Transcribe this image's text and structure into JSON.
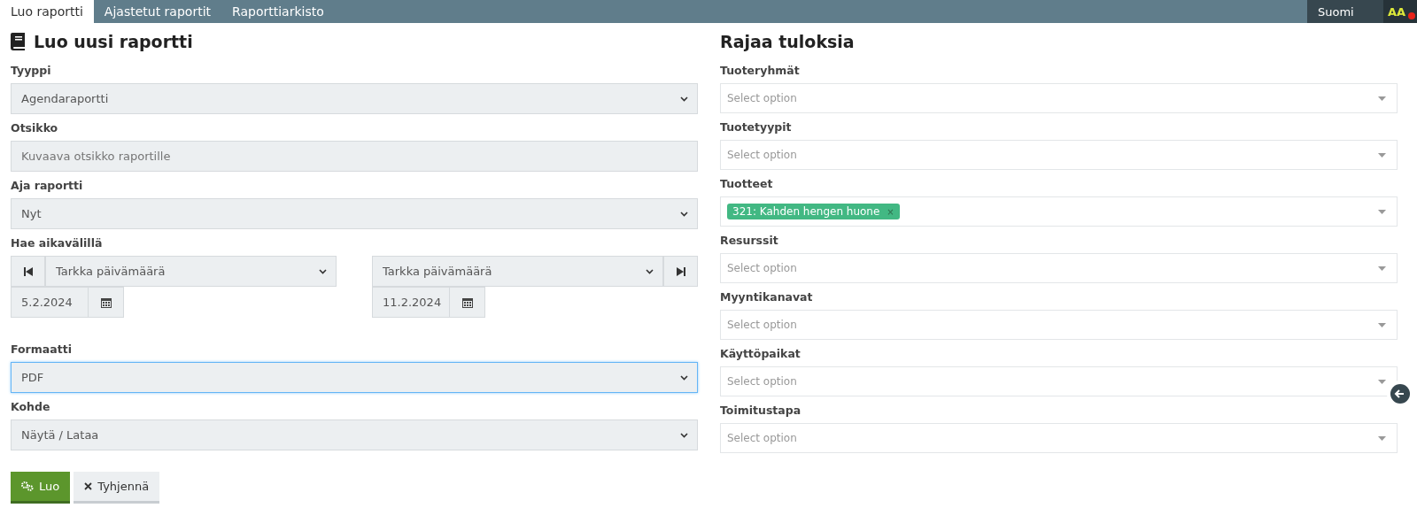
{
  "tabs": [
    {
      "label": "Luo raportti",
      "selected": true
    },
    {
      "label": "Ajastetut raportit",
      "selected": false
    },
    {
      "label": "Raporttiarkisto",
      "selected": false
    }
  ],
  "language": "Suomi",
  "accessibility": "AA",
  "form": {
    "title": "Luo uusi raportti",
    "fields_top": [
      {
        "kind": "select",
        "label": "Tyyppi",
        "value": "Agendaraportti",
        "focused": false
      },
      {
        "kind": "text",
        "label": "Otsikko",
        "placeholder": "Kuvaava otsikko raportille",
        "focused": false
      },
      {
        "kind": "select",
        "label": "Aja raportti",
        "value": "Nyt",
        "focused": false
      }
    ],
    "date_range": {
      "label": "Hae aikavälillä",
      "start": {
        "mode": "Tarkka päivämäärä",
        "date": "5.2.2024"
      },
      "end": {
        "mode": "Tarkka päivämäärä",
        "date": "11.2.2024"
      }
    },
    "fields_bottom": [
      {
        "kind": "select",
        "label": "Formaatti",
        "value": "PDF",
        "focused": true
      },
      {
        "kind": "select",
        "label": "Kohde",
        "value": "Näytä / Lataa",
        "focused": false
      }
    ],
    "buttons": [
      {
        "kind": "primary",
        "label": "Luo"
      },
      {
        "kind": "secondary",
        "label": "Tyhjennä"
      }
    ]
  },
  "filters": {
    "title": "Rajaa tuloksia",
    "items": [
      {
        "label": "Tuoteryhmät",
        "placeholder": "Select option"
      },
      {
        "label": "Tuotetyypit",
        "placeholder": "Select option"
      },
      {
        "label": "Tuotteet",
        "tags": [
          {
            "label": "321: Kahden hengen huone",
            "remove": "×"
          }
        ]
      },
      {
        "label": "Resurssit",
        "placeholder": "Select option"
      },
      {
        "label": "Myyntikanavat",
        "placeholder": "Select option"
      },
      {
        "label": "Käyttöpaikat",
        "placeholder": "Select option"
      },
      {
        "label": "Toimitustapa",
        "placeholder": "Select option"
      }
    ]
  }
}
